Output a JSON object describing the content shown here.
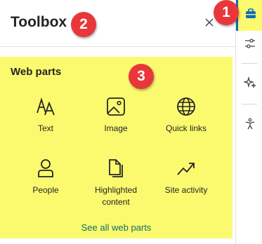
{
  "header": {
    "title": "Toolbox",
    "close_icon": "close-icon"
  },
  "badges": [
    "1",
    "2",
    "3"
  ],
  "web_parts": {
    "section_title": "Web parts",
    "tiles": [
      {
        "label": "Text",
        "icon": "text-icon"
      },
      {
        "label": "Image",
        "icon": "image-icon"
      },
      {
        "label": "Quick links",
        "icon": "globe-icon"
      },
      {
        "label": "People",
        "icon": "person-icon"
      },
      {
        "label": "Highlighted content",
        "icon": "documents-icon"
      },
      {
        "label": "Site activity",
        "icon": "trend-icon"
      }
    ],
    "see_all_label": "See all web parts"
  },
  "rail": {
    "items": [
      {
        "icon": "toolbox-icon",
        "active": true
      },
      {
        "icon": "settings-sliders-icon",
        "active": false
      },
      {
        "icon": "sparkle-icon",
        "active": false
      },
      {
        "icon": "accessibility-icon",
        "active": false
      }
    ]
  },
  "colors": {
    "highlight": "#fbfa6f",
    "badge": "#e8373b",
    "accent": "#0f6cbd",
    "link": "#0f6f66"
  }
}
